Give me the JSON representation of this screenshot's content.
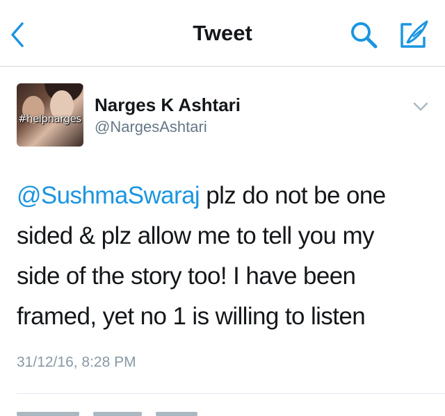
{
  "navbar": {
    "title": "Tweet",
    "back_icon": "chevron-left-icon",
    "search_icon": "search-icon",
    "compose_icon": "compose-icon",
    "accent_color": "#1b95e0"
  },
  "tweet": {
    "author": {
      "display_name": "Narges K Ashtari",
      "handle": "@NargesAshtari",
      "avatar_overlay_text": "#helpnarges"
    },
    "more_icon": "chevron-down-icon",
    "mention": "@SushmaSwaraj",
    "body_lines": [
      " plz do not be one",
      "sided & plz allow me to tell you my",
      "side of the story too! I have been",
      "framed, yet no 1 is willing to listen"
    ],
    "timestamp": "31/12/16, 8:28 PM"
  }
}
